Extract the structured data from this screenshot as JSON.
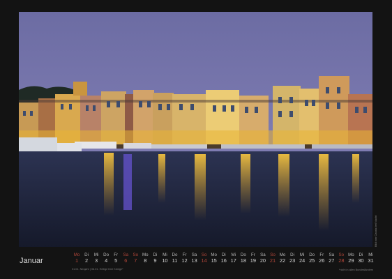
{
  "calendar": {
    "month": "Januar",
    "photo_credit": "Bild von Cassis bei Nacht",
    "days": [
      {
        "name": "Mo",
        "num": "1",
        "holiday": true
      },
      {
        "name": "Di",
        "num": "2"
      },
      {
        "name": "Mi",
        "num": "3"
      },
      {
        "name": "Do",
        "num": "4"
      },
      {
        "name": "Fr",
        "num": "5"
      },
      {
        "name": "Sa",
        "num": "6",
        "holiday": true
      },
      {
        "name": "So",
        "num": "7",
        "holiday": true
      },
      {
        "name": "Mo",
        "num": "8"
      },
      {
        "name": "Di",
        "num": "9"
      },
      {
        "name": "Mi",
        "num": "10"
      },
      {
        "name": "Do",
        "num": "11"
      },
      {
        "name": "Fr",
        "num": "12"
      },
      {
        "name": "Sa",
        "num": "13"
      },
      {
        "name": "So",
        "num": "14",
        "holiday": true
      },
      {
        "name": "Mo",
        "num": "15"
      },
      {
        "name": "Di",
        "num": "16"
      },
      {
        "name": "Mi",
        "num": "17"
      },
      {
        "name": "Do",
        "num": "18"
      },
      {
        "name": "Fr",
        "num": "19"
      },
      {
        "name": "Sa",
        "num": "20"
      },
      {
        "name": "So",
        "num": "21",
        "holiday": true
      },
      {
        "name": "Mo",
        "num": "22"
      },
      {
        "name": "Di",
        "num": "23"
      },
      {
        "name": "Mi",
        "num": "24"
      },
      {
        "name": "Do",
        "num": "25"
      },
      {
        "name": "Fr",
        "num": "26"
      },
      {
        "name": "Sa",
        "num": "27"
      },
      {
        "name": "So",
        "num": "28",
        "holiday": true
      },
      {
        "name": "Mo",
        "num": "29"
      },
      {
        "name": "Di",
        "num": "30"
      },
      {
        "name": "Mi",
        "num": "31"
      }
    ],
    "holiday_note": "01.01. Neujahr | 06.01. Heilige Drei Könige*",
    "footnote": "*nicht in allen Bundesländern"
  },
  "colors": {
    "background": "#131313",
    "sunday_holiday": "#b4473a",
    "sky_top": "#6f6ea6",
    "sky_bottom": "#8a86bb",
    "water": "#1d2338",
    "light_reflection": "#e9b533"
  }
}
